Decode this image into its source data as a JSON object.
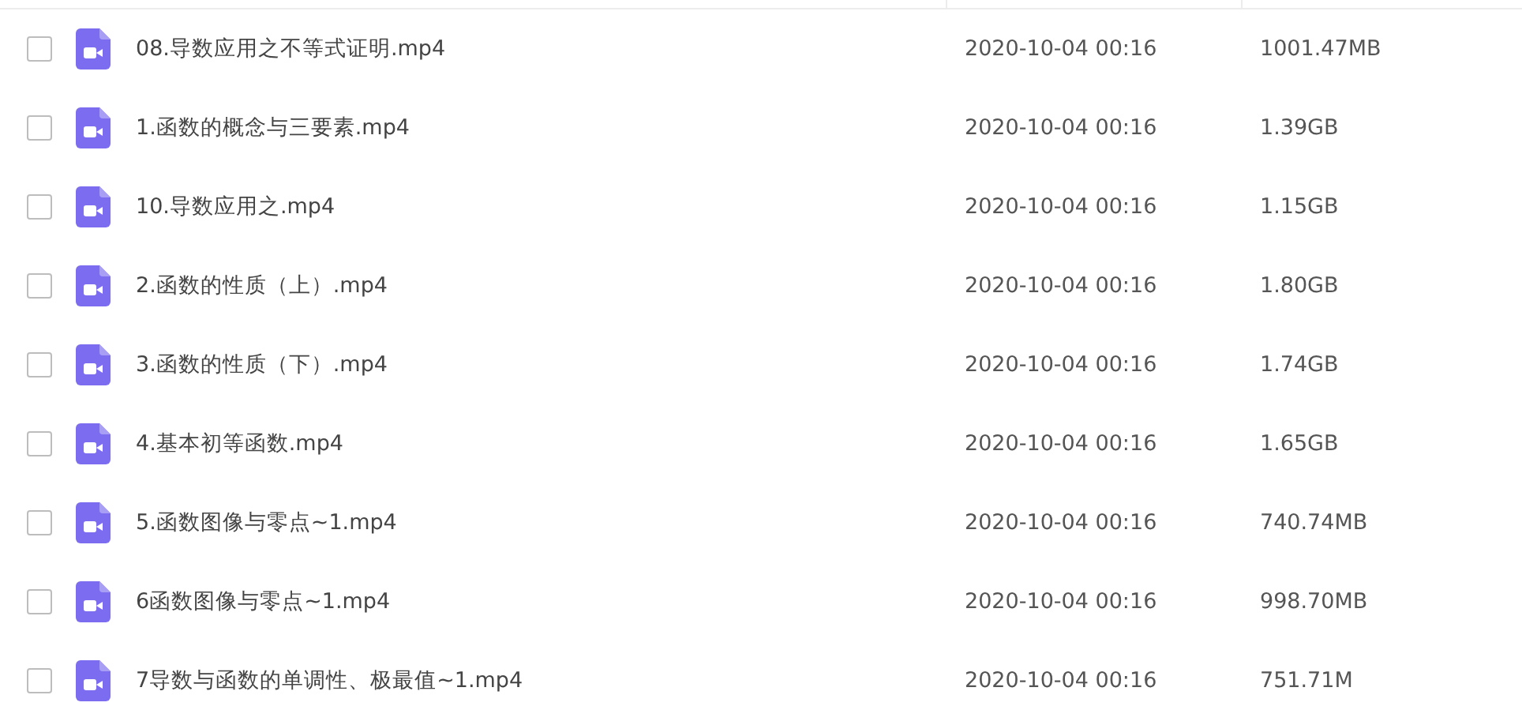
{
  "files": [
    {
      "name": "08.导数应用之不等式证明.mp4",
      "modified": "2020-10-04 00:16",
      "size": "1001.47MB",
      "checked": false
    },
    {
      "name": "1.函数的概念与三要素.mp4",
      "modified": "2020-10-04 00:16",
      "size": "1.39GB",
      "checked": false
    },
    {
      "name": "10.导数应用之.mp4",
      "modified": "2020-10-04 00:16",
      "size": "1.15GB",
      "checked": false
    },
    {
      "name": "2.函数的性质（上）.mp4",
      "modified": "2020-10-04 00:16",
      "size": "1.80GB",
      "checked": false
    },
    {
      "name": "3.函数的性质（下）.mp4",
      "modified": "2020-10-04 00:16",
      "size": "1.74GB",
      "checked": false
    },
    {
      "name": "4.基本初等函数.mp4",
      "modified": "2020-10-04 00:16",
      "size": "1.65GB",
      "checked": false
    },
    {
      "name": "5.函数图像与零点~1.mp4",
      "modified": "2020-10-04 00:16",
      "size": "740.74MB",
      "checked": false
    },
    {
      "name": "6函数图像与零点~1.mp4",
      "modified": "2020-10-04 00:16",
      "size": "998.70MB",
      "checked": false
    },
    {
      "name": "7导数与函数的单调性、极最值~1.mp4",
      "modified": "2020-10-04 00:16",
      "size": "751.71M",
      "checked": false
    }
  ]
}
